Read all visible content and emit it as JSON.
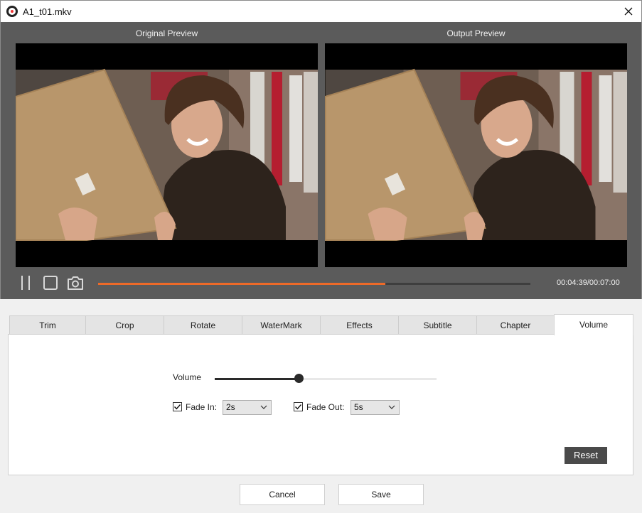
{
  "window": {
    "title": "A1_t01.mkv"
  },
  "preview": {
    "original_label": "Original Preview",
    "output_label": "Output Preview"
  },
  "player": {
    "timecode": "00:04:39/00:07:00",
    "progress": 0.664,
    "accent_color": "#ee6a28"
  },
  "tabs": [
    {
      "label": "Trim"
    },
    {
      "label": "Crop"
    },
    {
      "label": "Rotate"
    },
    {
      "label": "WaterMark"
    },
    {
      "label": "Effects"
    },
    {
      "label": "Subtitle"
    },
    {
      "label": "Chapter"
    },
    {
      "label": "Volume",
      "active": true
    }
  ],
  "volume_panel": {
    "volume_label": "Volume",
    "volume_level": 0.38,
    "fade_in": {
      "label": "Fade In:",
      "checked": true,
      "value": "2s"
    },
    "fade_out": {
      "label": "Fade Out:",
      "checked": true,
      "value": "5s"
    },
    "reset_label": "Reset"
  },
  "footer": {
    "cancel_label": "Cancel",
    "save_label": "Save"
  }
}
